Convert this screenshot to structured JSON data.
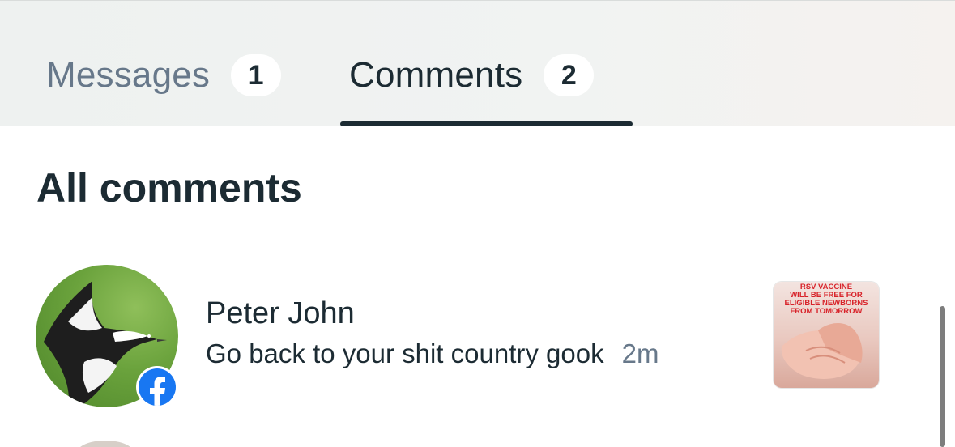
{
  "tabs": [
    {
      "label": "Messages",
      "count": "1",
      "active": false
    },
    {
      "label": "Comments",
      "count": "2",
      "active": true
    }
  ],
  "section": {
    "title": "All comments"
  },
  "comments": [
    {
      "name": "Peter John",
      "text": "Go back to your shit country gook",
      "time": "2m",
      "platform_icon": "facebook-icon",
      "thumbnail": {
        "lines": [
          "RSV VACCINE",
          "WILL BE FREE FOR",
          "ELIGIBLE NEWBORNS",
          "FROM TOMORROW"
        ]
      }
    }
  ],
  "colors": {
    "active_text": "#1c2b33",
    "inactive_text": "#67788a",
    "facebook_blue": "#1877f2",
    "indicator": "#1c2b33"
  }
}
